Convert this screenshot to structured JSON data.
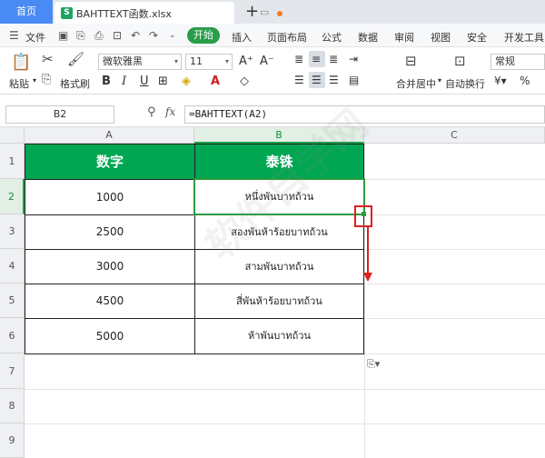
{
  "tabs": {
    "home": "首页",
    "file_badge": "S",
    "file_name": "BAHTTEXT函数.xlsx",
    "add": "+"
  },
  "menu": {
    "file": "文件",
    "start": "开始",
    "items": [
      "插入",
      "页面布局",
      "公式",
      "数据",
      "审阅",
      "视图",
      "安全",
      "开发工具"
    ]
  },
  "ribbon": {
    "paste": "粘贴",
    "format_painter": "格式刷",
    "font_name": "微软雅黑",
    "font_size": "11",
    "merge_center": "合并居中",
    "auto_wrap": "自动换行",
    "number_format": "常规",
    "percent": "%"
  },
  "formula_bar": {
    "cell_ref": "B2",
    "fx": "fx",
    "formula": "=BAHTTEXT(A2)"
  },
  "columns": [
    "A",
    "B",
    "C"
  ],
  "rows": [
    "1",
    "2",
    "3",
    "4",
    "5",
    "6",
    "7",
    "8",
    "9"
  ],
  "table": {
    "headers": [
      "数字",
      "泰铢"
    ],
    "data": [
      [
        "1000",
        "หนึ่งพันบาทถ้วน"
      ],
      [
        "2500",
        "สองพันห้าร้อยบาทถ้วน"
      ],
      [
        "3000",
        "สามพันบาทถ้วน"
      ],
      [
        "4500",
        "สี่พันห้าร้อยบาทถ้วน"
      ],
      [
        "5000",
        "ห้าพันบาทถ้วน"
      ]
    ]
  },
  "colors": {
    "header_green": "#00a651",
    "selection_green": "#2b9b3f",
    "annotation_red": "#e02020"
  }
}
